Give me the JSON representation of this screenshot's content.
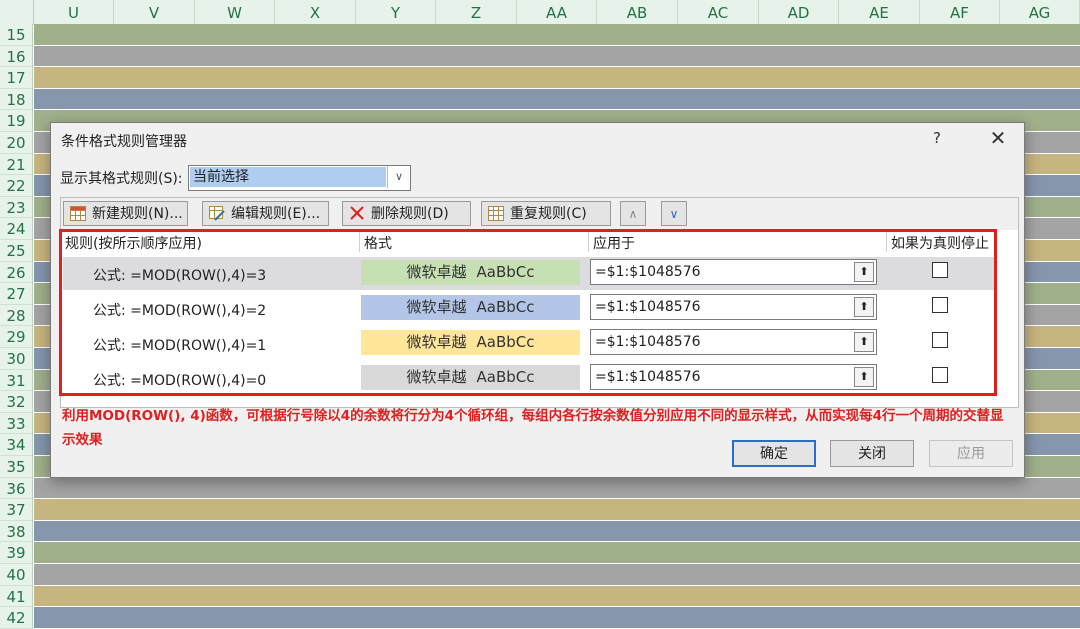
{
  "sheet": {
    "columns": [
      "U",
      "V",
      "W",
      "X",
      "Y",
      "Z",
      "AA",
      "AB",
      "AC",
      "AD",
      "AE",
      "AF",
      "AG"
    ],
    "rows": [
      "15",
      "16",
      "17",
      "18",
      "19",
      "20",
      "21",
      "22",
      "23",
      "24",
      "25",
      "26",
      "27",
      "28",
      "29",
      "30",
      "31",
      "32",
      "33",
      "34",
      "35",
      "36",
      "37",
      "38",
      "39",
      "40",
      "41",
      "42"
    ],
    "band_colors": {
      "mod0": "#a4a4a4",
      "mod1": "#c7b57f",
      "mod2": "#8596ad",
      "mod3": "#9fb08b"
    }
  },
  "dialog": {
    "title": "条件格式规则管理器",
    "help": "?",
    "close": "✕",
    "show_label": "显示其格式规则(S):",
    "show_value": "当前选择",
    "toolbar": {
      "new_rule": "新建规则(N)...",
      "edit_rule": "编辑规则(E)...",
      "delete_rule": "删除规则(D)",
      "duplicate_rule": "重复规则(C)",
      "move_up": "∧",
      "move_down": "∨"
    },
    "headers": {
      "rule": "规则(按所示顺序应用)",
      "format": "格式",
      "applies_to": "应用于",
      "stop_if_true": "如果为真则停止"
    },
    "rules": [
      {
        "formula": "公式: =MOD(ROW(),4)=3",
        "preview_text": "微软卓越",
        "preview_sample": "AaBbCc",
        "preview_color": "#c6e0b4",
        "applies_to": "=$1:$1048576",
        "selected": true
      },
      {
        "formula": "公式: =MOD(ROW(),4)=2",
        "preview_text": "微软卓越",
        "preview_sample": "AaBbCc",
        "preview_color": "#b4c6e7",
        "applies_to": "=$1:$1048576",
        "selected": false
      },
      {
        "formula": "公式: =MOD(ROW(),4)=1",
        "preview_text": "微软卓越",
        "preview_sample": "AaBbCc",
        "preview_color": "#ffe699",
        "applies_to": "=$1:$1048576",
        "selected": false
      },
      {
        "formula": "公式: =MOD(ROW(),4)=0",
        "preview_text": "微软卓越",
        "preview_sample": "AaBbCc",
        "preview_color": "#d9d9d9",
        "applies_to": "=$1:$1048576",
        "selected": false
      }
    ],
    "note": "利用MOD(ROW(), 4)函数，可根据行号除以4的余数将行分为4个循环组，每组内各行按余数值分别应用不同的显示样式，从而实现每4行一个周期的交替显示效果",
    "buttons": {
      "ok": "确定",
      "close": "关闭",
      "apply": "应用"
    }
  }
}
